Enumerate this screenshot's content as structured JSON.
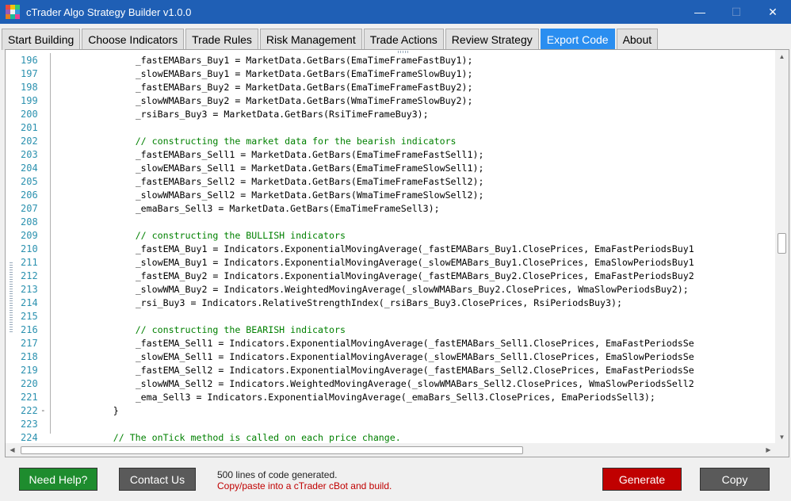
{
  "window": {
    "title": "cTrader Algo Strategy Builder v1.0.0",
    "controls": {
      "minimize": "—",
      "maximize": "☐",
      "close": "✕"
    }
  },
  "tabs": [
    {
      "label": "Start Building",
      "active": false
    },
    {
      "label": "Choose Indicators",
      "active": false
    },
    {
      "label": "Trade Rules",
      "active": false
    },
    {
      "label": "Risk Management",
      "active": false
    },
    {
      "label": "Trade Actions",
      "active": false
    },
    {
      "label": "Review Strategy",
      "active": false
    },
    {
      "label": "Export Code",
      "active": true
    },
    {
      "label": "About",
      "active": false
    }
  ],
  "editor": {
    "lines": [
      {
        "num": "196",
        "fold": "",
        "indent": "                ",
        "text": "_fastEMABars_Buy1 = MarketData.GetBars(EmaTimeFrameFastBuy1);",
        "comment": false
      },
      {
        "num": "197",
        "fold": "",
        "indent": "                ",
        "text": "_slowEMABars_Buy1 = MarketData.GetBars(EmaTimeFrameSlowBuy1);",
        "comment": false
      },
      {
        "num": "198",
        "fold": "",
        "indent": "                ",
        "text": "_fastEMABars_Buy2 = MarketData.GetBars(EmaTimeFrameFastBuy2);",
        "comment": false
      },
      {
        "num": "199",
        "fold": "",
        "indent": "                ",
        "text": "_slowWMABars_Buy2 = MarketData.GetBars(WmaTimeFrameSlowBuy2);",
        "comment": false
      },
      {
        "num": "200",
        "fold": "",
        "indent": "                ",
        "text": "_rsiBars_Buy3 = MarketData.GetBars(RsiTimeFrameBuy3);",
        "comment": false
      },
      {
        "num": "201",
        "fold": "",
        "indent": "",
        "text": "",
        "comment": false
      },
      {
        "num": "202",
        "fold": "",
        "indent": "                ",
        "text": "// constructing the market data for the bearish indicators",
        "comment": true
      },
      {
        "num": "203",
        "fold": "",
        "indent": "                ",
        "text": "_fastEMABars_Sell1 = MarketData.GetBars(EmaTimeFrameFastSell1);",
        "comment": false
      },
      {
        "num": "204",
        "fold": "",
        "indent": "                ",
        "text": "_slowEMABars_Sell1 = MarketData.GetBars(EmaTimeFrameSlowSell1);",
        "comment": false
      },
      {
        "num": "205",
        "fold": "",
        "indent": "                ",
        "text": "_fastEMABars_Sell2 = MarketData.GetBars(EmaTimeFrameFastSell2);",
        "comment": false
      },
      {
        "num": "206",
        "fold": "",
        "indent": "                ",
        "text": "_slowWMABars_Sell2 = MarketData.GetBars(WmaTimeFrameSlowSell2);",
        "comment": false
      },
      {
        "num": "207",
        "fold": "",
        "indent": "                ",
        "text": "_emaBars_Sell3 = MarketData.GetBars(EmaTimeFrameSell3);",
        "comment": false
      },
      {
        "num": "208",
        "fold": "",
        "indent": "",
        "text": "",
        "comment": false
      },
      {
        "num": "209",
        "fold": "",
        "indent": "                ",
        "text": "// constructing the BULLISH indicators",
        "comment": true
      },
      {
        "num": "210",
        "fold": "",
        "indent": "                ",
        "text": "_fastEMA_Buy1 = Indicators.ExponentialMovingAverage(_fastEMABars_Buy1.ClosePrices, EmaFastPeriodsBuy1",
        "comment": false
      },
      {
        "num": "211",
        "fold": "",
        "indent": "                ",
        "text": "_slowEMA_Buy1 = Indicators.ExponentialMovingAverage(_slowEMABars_Buy1.ClosePrices, EmaSlowPeriodsBuy1",
        "comment": false
      },
      {
        "num": "212",
        "fold": "",
        "indent": "                ",
        "text": "_fastEMA_Buy2 = Indicators.ExponentialMovingAverage(_fastEMABars_Buy2.ClosePrices, EmaFastPeriodsBuy2",
        "comment": false
      },
      {
        "num": "213",
        "fold": "",
        "indent": "                ",
        "text": "_slowWMA_Buy2 = Indicators.WeightedMovingAverage(_slowWMABars_Buy2.ClosePrices, WmaSlowPeriodsBuy2);",
        "comment": false
      },
      {
        "num": "214",
        "fold": "",
        "indent": "                ",
        "text": "_rsi_Buy3 = Indicators.RelativeStrengthIndex(_rsiBars_Buy3.ClosePrices, RsiPeriodsBuy3);",
        "comment": false
      },
      {
        "num": "215",
        "fold": "",
        "indent": "",
        "text": "",
        "comment": false
      },
      {
        "num": "216",
        "fold": "",
        "indent": "                ",
        "text": "// constructing the BEARISH indicators",
        "comment": true
      },
      {
        "num": "217",
        "fold": "",
        "indent": "                ",
        "text": "_fastEMA_Sell1 = Indicators.ExponentialMovingAverage(_fastEMABars_Sell1.ClosePrices, EmaFastPeriodsSe",
        "comment": false
      },
      {
        "num": "218",
        "fold": "",
        "indent": "                ",
        "text": "_slowEMA_Sell1 = Indicators.ExponentialMovingAverage(_slowEMABars_Sell1.ClosePrices, EmaSlowPeriodsSe",
        "comment": false
      },
      {
        "num": "219",
        "fold": "",
        "indent": "                ",
        "text": "_fastEMA_Sell2 = Indicators.ExponentialMovingAverage(_fastEMABars_Sell2.ClosePrices, EmaFastPeriodsSe",
        "comment": false
      },
      {
        "num": "220",
        "fold": "",
        "indent": "                ",
        "text": "_slowWMA_Sell2 = Indicators.WeightedMovingAverage(_slowWMABars_Sell2.ClosePrices, WmaSlowPeriodsSell2",
        "comment": false
      },
      {
        "num": "221",
        "fold": "",
        "indent": "                ",
        "text": "_ema_Sell3 = Indicators.ExponentialMovingAverage(_emaBars_Sell3.ClosePrices, EmaPeriodsSell3);",
        "comment": false
      },
      {
        "num": "222",
        "fold": "-",
        "indent": "            ",
        "text": "}",
        "comment": false
      },
      {
        "num": "223",
        "fold": "",
        "indent": "",
        "text": "",
        "comment": false
      },
      {
        "num": "224",
        "fold": "",
        "indent": "            ",
        "text": "// The onTick method is called on each price change.",
        "comment": true
      }
    ]
  },
  "footer": {
    "help_label": "Need Help?",
    "contact_label": "Contact Us",
    "status_line1": "500 lines of code generated.",
    "status_line2": "Copy/paste into a cTrader cBot and build.",
    "generate_label": "Generate",
    "copy_label": "Copy"
  },
  "colors": {
    "titlebar": "#1f5fb5",
    "active_tab": "#2a8ef0",
    "help_button": "#1e8c2e",
    "contact_button": "#5a5a5a",
    "generate_button": "#c00000",
    "copy_button": "#5a5a5a",
    "code_comment": "#008000",
    "line_number": "#2b91af",
    "status_warning": "#c00000"
  }
}
